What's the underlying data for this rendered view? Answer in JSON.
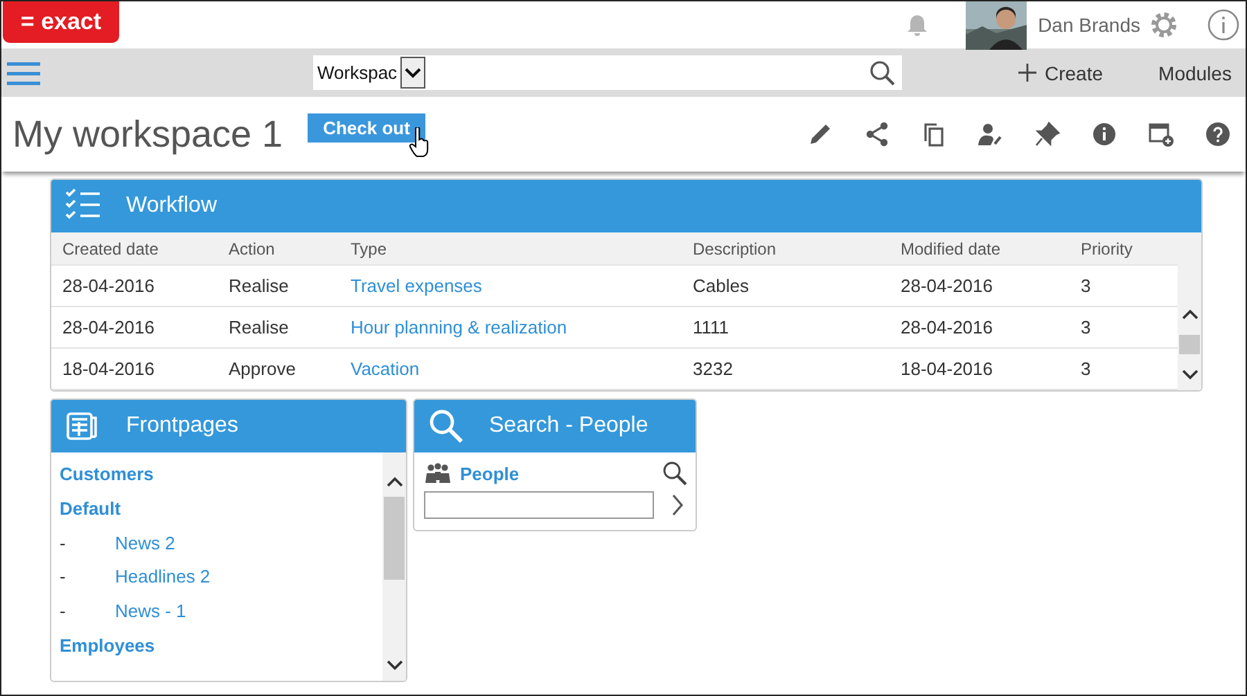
{
  "logo": "= exact",
  "user": {
    "name": "Dan Brands"
  },
  "nav": {
    "search_scope": "Workspac",
    "create": "Create",
    "modules": "Modules"
  },
  "page": {
    "title": "My workspace 1",
    "check_out": "Check out"
  },
  "workflow": {
    "title": "Workflow",
    "columns": [
      {
        "label": "Created date",
        "kind": "text"
      },
      {
        "label": "Action",
        "kind": "text"
      },
      {
        "label": "Type",
        "kind": "link"
      },
      {
        "label": "Description",
        "kind": "text"
      },
      {
        "label": "Modified date",
        "kind": "text"
      },
      {
        "label": "Priority",
        "kind": "text"
      }
    ],
    "rows": [
      [
        "28-04-2016",
        "Realise",
        "Travel expenses",
        "Cables",
        "28-04-2016",
        "3"
      ],
      [
        "28-04-2016",
        "Realise",
        "Hour planning & realization",
        "1111",
        "28-04-2016",
        "3"
      ],
      [
        "18-04-2016",
        "Approve",
        "Vacation",
        "3232",
        "18-04-2016",
        "3"
      ]
    ]
  },
  "frontpages": {
    "title": "Frontpages",
    "items": [
      {
        "label": "Customers"
      },
      {
        "label": "Default",
        "children": [
          {
            "marker": "-",
            "label": "News 2"
          },
          {
            "marker": "-",
            "label": "Headlines 2"
          },
          {
            "marker": "-",
            "label": "News - 1"
          }
        ]
      },
      {
        "label": "Employees"
      }
    ]
  },
  "search_people": {
    "title": "Search - People",
    "section": "People"
  }
}
